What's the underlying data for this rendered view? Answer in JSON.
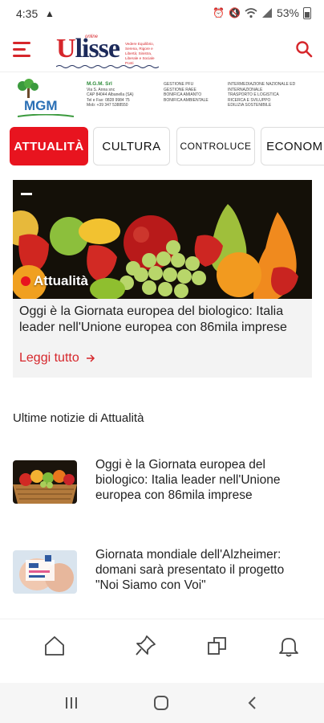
{
  "status_bar": {
    "time": "4:35",
    "battery": "53%",
    "icons": [
      "alert-icon",
      "alarm-icon",
      "mute-icon",
      "wifi-icon",
      "signal-icon",
      "battery-icon"
    ]
  },
  "header": {
    "logo_text": "Ulisse",
    "logo_online": "online",
    "logo_tagline": "Vedere Equilibrio, Serena, Rigore e Libertà; Sinistra, Liberale e Sociale Ponti",
    "menu_icon": "hamburger-icon",
    "search_icon": "search-icon"
  },
  "banner": {
    "company": "M.G.M. Srl",
    "address": [
      "Via S. Anna snc",
      "CAP 84044 Albanella (SA)",
      "Tel e Fax: 0828 9984 75",
      "Mob: +39 347 5388550"
    ],
    "services_1": [
      "GESTIONE PFU",
      "GESTIONE RAEE",
      "BONIFICA AMIANTO",
      "BONIFICA AMBIENTALE"
    ],
    "services_2": [
      "INTERMEDIAZIONE NAZIONALE ED INTERNAZIONALE",
      "TRASPORTO E LOGISTICA",
      "RICERCA E SVILUPPO",
      "EDILIZIA SOSTENIBILE"
    ],
    "logo_word": "MGM"
  },
  "tabs": [
    {
      "label": "ATTUALITÀ",
      "active": true
    },
    {
      "label": "CULTURA",
      "active": false
    },
    {
      "label": "CONTROLUCE",
      "active": false
    },
    {
      "label": "ECONOMIA",
      "active": false
    }
  ],
  "featured": {
    "category": "Attualità",
    "title": "Oggi è la Giornata europea del biologico: Italia leader nell'Unione europea con 86mila imprese",
    "read_more": "Leggi tutto"
  },
  "section_title": "Ultime notizie di Attualità",
  "news": [
    {
      "title": "Oggi è la Giornata europea del biologico: Italia leader nell'Unione europea con 86mila imprese"
    },
    {
      "title": "Giornata mondiale dell'Alzheimer: domani sarà presentato il progetto \"Noi Siamo con Voi\""
    }
  ],
  "bottom_nav": [
    "home-icon",
    "pin-icon",
    "copy-icon",
    "bell-icon"
  ],
  "system_nav": [
    "recents-icon",
    "home-circle-icon",
    "back-icon"
  ],
  "colors": {
    "accent": "#e8141f",
    "brand_red": "#d6262b",
    "brand_navy": "#1c2a5a"
  }
}
